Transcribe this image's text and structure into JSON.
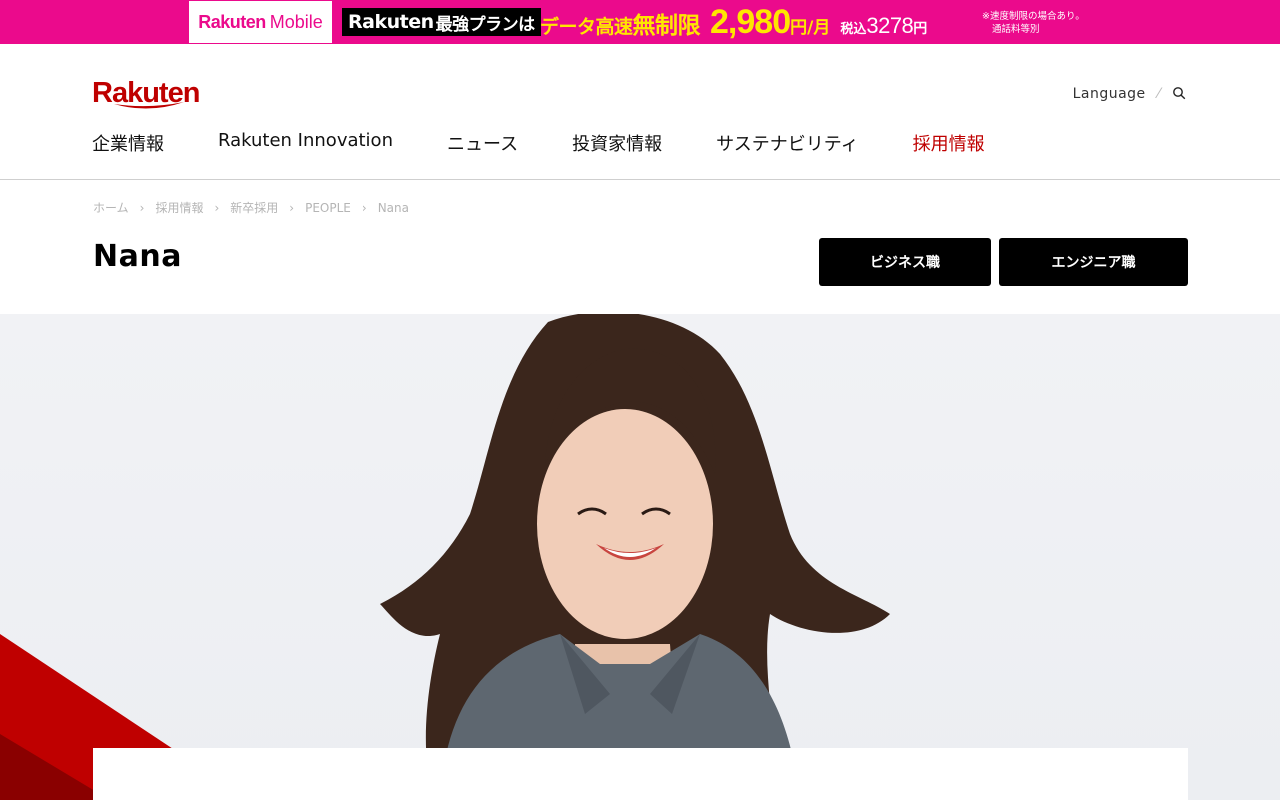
{
  "promo": {
    "mobile_logo_brand": "Rakuten",
    "mobile_logo_product": "Mobile",
    "plan_brand": "Rakuten",
    "plan_name": "最強プランは",
    "headline_part1": "データ高速",
    "headline_part2": "無制限",
    "price": "2,980",
    "price_unit": "円/月",
    "tax_label": "税込",
    "tax_price": "3278",
    "tax_unit": "円",
    "note_line1": "※速度制限の場合あり。",
    "note_line2": "通話料等別",
    "colors": {
      "background": "#eb0a8c",
      "highlight": "#ffe600"
    }
  },
  "header": {
    "logo": "Rakuten",
    "language": "Language",
    "search_icon": "search-icon",
    "nav": [
      {
        "label": "企業情報",
        "active": false
      },
      {
        "label": "Rakuten Innovation",
        "active": false
      },
      {
        "label": "ニュース",
        "active": false
      },
      {
        "label": "投資家情報",
        "active": false
      },
      {
        "label": "サステナビリティ",
        "active": false
      },
      {
        "label": "採用情報",
        "active": true
      }
    ],
    "colors": {
      "brand": "#bf0000"
    }
  },
  "breadcrumb": [
    "ホーム",
    "採用情報",
    "新卒採用",
    "PEOPLE",
    "Nana"
  ],
  "page": {
    "title": "Nana",
    "buttons": {
      "business": "ビジネス職",
      "engineer": "エンジニア職"
    }
  }
}
